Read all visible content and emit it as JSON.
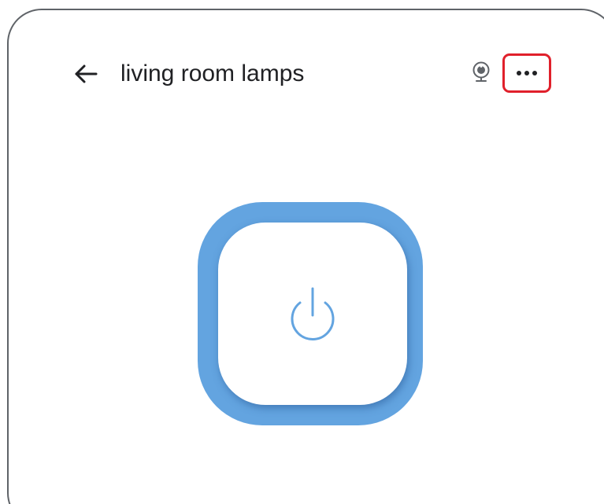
{
  "header": {
    "title": "living room lamps",
    "back_icon": "arrow-left-icon",
    "camera_icon": "webcam-icon",
    "more_icon": "more-horizontal-icon"
  },
  "power_control": {
    "icon": "power-icon"
  },
  "colors": {
    "accent": "#63a4e0",
    "highlight_border": "#e0202b",
    "text": "#202124",
    "icon": "#202124"
  }
}
